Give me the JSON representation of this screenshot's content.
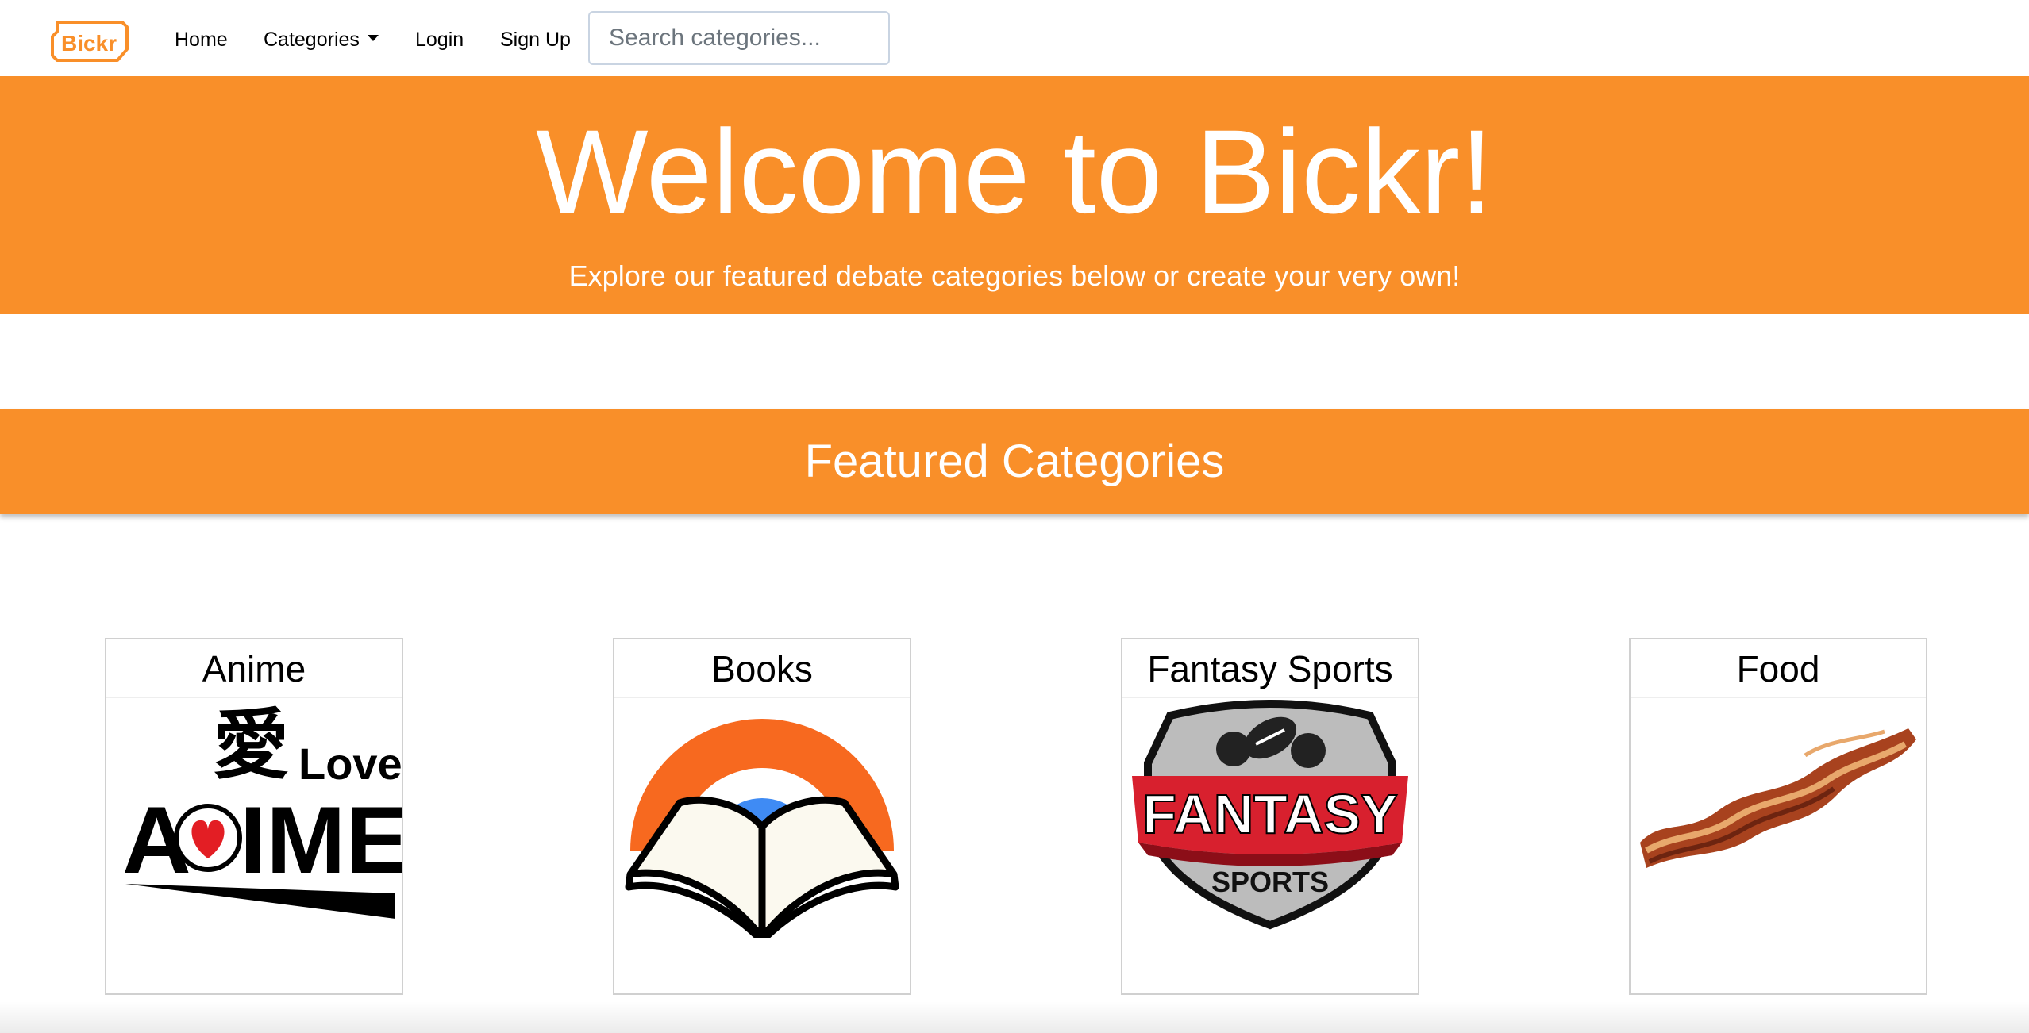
{
  "navbar": {
    "brand_text": "Bickr",
    "brand_color": "#f98f29",
    "links": [
      {
        "label": "Home"
      },
      {
        "label": "Categories"
      },
      {
        "label": "Login"
      },
      {
        "label": "Sign Up"
      }
    ],
    "search": {
      "placeholder": "Search categories...",
      "value": ""
    }
  },
  "hero": {
    "title": "Welcome to Bickr!",
    "subtitle": "Explore our featured debate categories below or create your very own!",
    "background": "#f98f29"
  },
  "featured": {
    "title": "Featured Categories",
    "categories": [
      {
        "title": "Anime",
        "icon": "love-anime-logo"
      },
      {
        "title": "Books",
        "icon": "open-book-logo"
      },
      {
        "title": "Fantasy Sports",
        "icon": "fantasy-sports-shield"
      },
      {
        "title": "Food",
        "icon": "bacon-strip"
      }
    ]
  },
  "images_text": {
    "anime_kanji": "愛",
    "anime_love": "Love",
    "anime_word": "A IME",
    "fantasy_line1": "FANTASY",
    "fantasy_line2": "SPORTS"
  }
}
